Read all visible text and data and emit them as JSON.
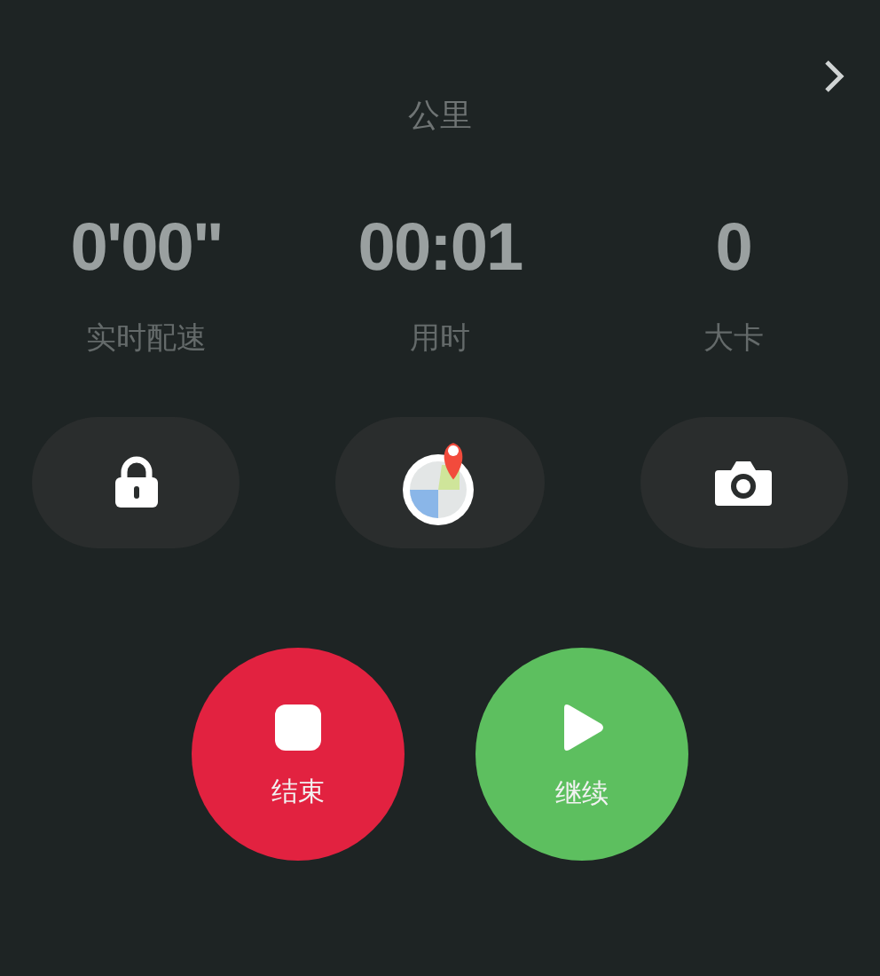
{
  "distance": {
    "unit": "公里"
  },
  "stats": [
    {
      "value": "0'00\"",
      "label": "实时配速"
    },
    {
      "value": "00:01",
      "label": "用时"
    },
    {
      "value": "0",
      "label": "大卡"
    }
  ],
  "tools": [
    {
      "kind": "lock"
    },
    {
      "kind": "map"
    },
    {
      "kind": "camera"
    }
  ],
  "actions": [
    {
      "kind": "stop",
      "label": "结束",
      "color": "#e22240"
    },
    {
      "kind": "play",
      "label": "继续",
      "color": "#5dbf5f"
    }
  ]
}
